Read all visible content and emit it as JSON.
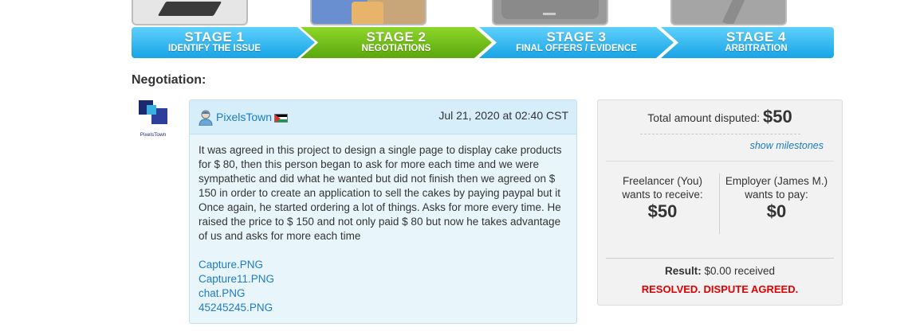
{
  "stages": [
    {
      "title": "STAGE 1",
      "subtitle": "IDENTIFY THE ISSUE",
      "state": "complete",
      "color": "#17a4e6"
    },
    {
      "title": "STAGE 2",
      "subtitle": "NEGOTIATIONS",
      "state": "current",
      "color": "#5aa80c"
    },
    {
      "title": "STAGE 3",
      "subtitle": "FINAL OFFERS / EVIDENCE",
      "state": "upcoming",
      "color": "#17a4e6"
    },
    {
      "title": "STAGE 4",
      "subtitle": "ARBITRATION",
      "state": "upcoming",
      "color": "#17a4e6"
    }
  ],
  "negotiation_heading": "Negotiation:",
  "logo": {
    "name": "PixelsTown",
    "icon": "pixelstown-logo"
  },
  "message": {
    "username": "PixelsTown",
    "avatar_icon": "user-avatar-icon",
    "flag_icon": "jordan-flag-icon",
    "date": "Jul 21, 2020 at 02:40 CST",
    "body": "It was agreed in this project to design a single page to display cake products for $ 80, then this person began to ask for more each time and we were sympathetic and did what he wanted but did not finish then we agreed on $ 150 in order to create an application to sell the cakes by paying paypal but it Once again, he started ordering a lot of things. Asks for more every time. He raised the price to $ 150 and not only paid $ 80 but now he takes advantage of us and asks for more each time",
    "attachments": [
      "Capture.PNG",
      "Capture11.PNG",
      "chat.PNG",
      "45245245.PNG"
    ]
  },
  "summary": {
    "total_label": "Total amount disputed:",
    "total_amount": "$50",
    "show_milestones": "show milestones",
    "freelancer_label_1": "Freelancer (You)",
    "freelancer_label_2": "wants to receive:",
    "freelancer_amount": "$50",
    "employer_label_1": "Employer (James M.)",
    "employer_label_2": "wants to pay:",
    "employer_amount": "$0",
    "result_label": "Result:",
    "result_value": "$0.00 received",
    "status": "RESOLVED. DISPUTE AGREED.",
    "status_color": "#e00000"
  },
  "colors": {
    "accent": "#1f7bc4",
    "stage_blue": "#17a4e6",
    "stage_green": "#5aa80c"
  }
}
